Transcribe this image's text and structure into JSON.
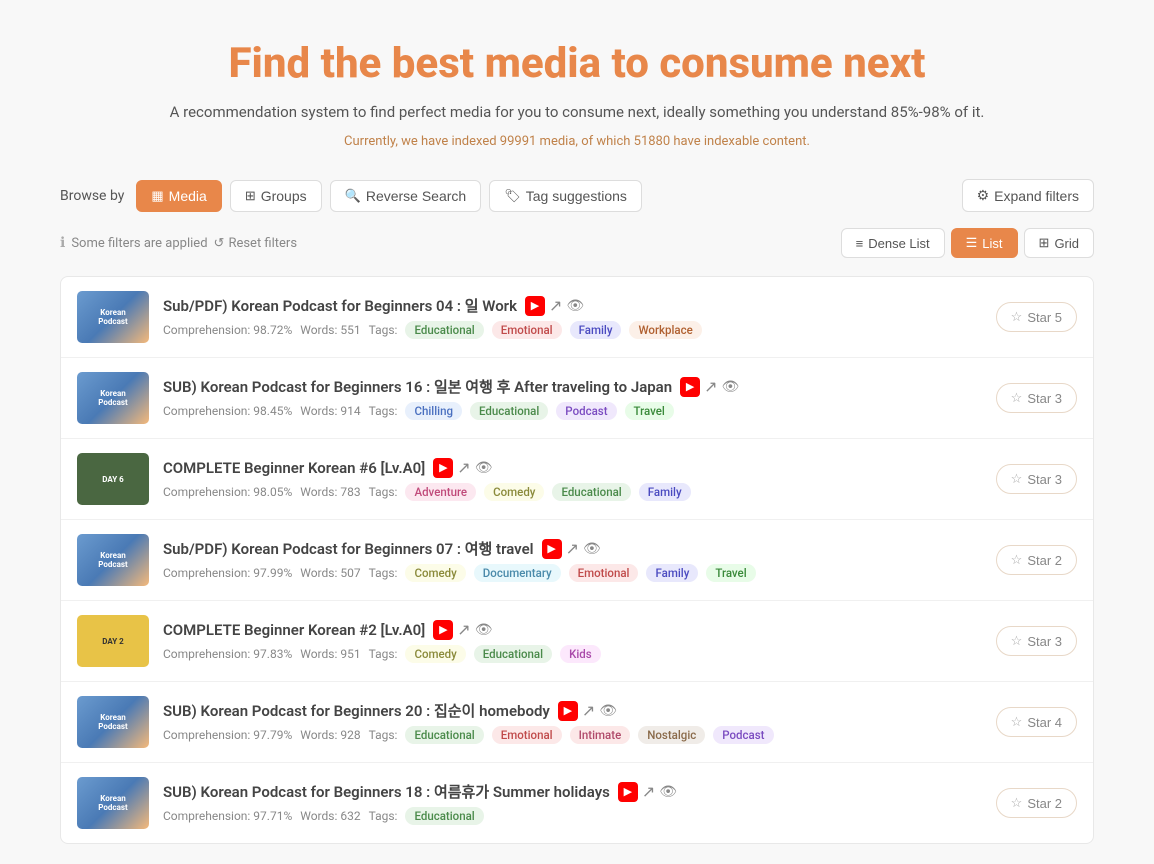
{
  "page": {
    "title": "Find the best media to consume next",
    "subtitle": "A recommendation system to find perfect media for you to consume next, ideally something you understand 85%-98% of it.",
    "stats": "Currently, we have indexed 99991 media, of which 51880 have indexable content."
  },
  "browse": {
    "label": "Browse by",
    "buttons": [
      {
        "id": "media",
        "label": "Media",
        "icon": "▦",
        "active": true
      },
      {
        "id": "groups",
        "label": "Groups",
        "icon": "⊞",
        "active": false
      },
      {
        "id": "reverse",
        "label": "Reverse Search",
        "icon": "🔍",
        "active": false
      },
      {
        "id": "tags",
        "label": "Tag suggestions",
        "icon": "🏷",
        "active": false
      }
    ],
    "expand_label": "Expand filters"
  },
  "filters": {
    "info": "Some filters are applied",
    "reset": "Reset filters"
  },
  "view": {
    "options": [
      {
        "id": "dense",
        "label": "Dense List",
        "icon": "≡",
        "active": false
      },
      {
        "id": "list",
        "label": "List",
        "icon": "☰",
        "active": true
      },
      {
        "id": "grid",
        "label": "Grid",
        "icon": "⊞",
        "active": false
      }
    ]
  },
  "media_items": [
    {
      "id": 1,
      "title": "Sub/PDF) Korean Podcast for Beginners 04 : 일 Work",
      "thumb_type": "podcast",
      "comprehension": "98.72%",
      "words": "551",
      "tags": [
        "Educational",
        "Emotional",
        "Family",
        "Workplace"
      ],
      "tag_types": [
        "educational",
        "emotional",
        "family",
        "workplace"
      ],
      "has_yt": true,
      "has_ext": true,
      "has_eye": true,
      "stars": 5
    },
    {
      "id": 2,
      "title": "SUB) Korean Podcast for Beginners 16 : 일본 여행 후 After traveling to Japan",
      "thumb_type": "podcast",
      "comprehension": "98.45%",
      "words": "914",
      "tags": [
        "Chilling",
        "Educational",
        "Podcast",
        "Travel"
      ],
      "tag_types": [
        "chilling",
        "educational",
        "podcast",
        "travel"
      ],
      "has_yt": true,
      "has_ext": true,
      "has_eye": true,
      "stars": 3
    },
    {
      "id": 3,
      "title": "COMPLETE Beginner Korean #6 [Lv.A0]",
      "thumb_type": "day6",
      "thumb_label": "DAY 6",
      "comprehension": "98.05%",
      "words": "783",
      "tags": [
        "Adventure",
        "Comedy",
        "Educational",
        "Family"
      ],
      "tag_types": [
        "adventure",
        "comedy",
        "educational",
        "family"
      ],
      "has_yt": true,
      "has_ext": true,
      "has_eye": true,
      "stars": 3
    },
    {
      "id": 4,
      "title": "Sub/PDF) Korean Podcast for Beginners 07 : 여행 travel",
      "thumb_type": "podcast",
      "comprehension": "97.99%",
      "words": "507",
      "tags": [
        "Comedy",
        "Documentary",
        "Emotional",
        "Family",
        "Travel"
      ],
      "tag_types": [
        "comedy",
        "documentary",
        "emotional",
        "family",
        "travel"
      ],
      "has_yt": true,
      "has_ext": true,
      "has_eye": true,
      "stars": 2
    },
    {
      "id": 5,
      "title": "COMPLETE Beginner Korean #2 [Lv.A0]",
      "thumb_type": "day2",
      "thumb_label": "DAY 2",
      "comprehension": "97.83%",
      "words": "951",
      "tags": [
        "Comedy",
        "Educational",
        "Kids"
      ],
      "tag_types": [
        "comedy",
        "educational",
        "kids"
      ],
      "has_yt": true,
      "has_ext": true,
      "has_eye": true,
      "stars": 3
    },
    {
      "id": 6,
      "title": "SUB) Korean Podcast for Beginners 20 : 집순이 homebody",
      "thumb_type": "podcast",
      "comprehension": "97.79%",
      "words": "928",
      "tags": [
        "Educational",
        "Emotional",
        "Intimate",
        "Nostalgic",
        "Podcast"
      ],
      "tag_types": [
        "educational",
        "emotional",
        "intimate",
        "nostalgic",
        "podcast"
      ],
      "has_yt": true,
      "has_ext": true,
      "has_eye": true,
      "stars": 4
    },
    {
      "id": 7,
      "title": "SUB) Korean Podcast for Beginners 18 : 여름휴가 Summer holidays",
      "thumb_type": "podcast",
      "comprehension": "97.71%",
      "words": "632",
      "tags": [
        "Educational"
      ],
      "tag_types": [
        "educational"
      ],
      "has_yt": true,
      "has_ext": true,
      "has_eye": true,
      "stars": 2
    }
  ],
  "labels": {
    "comprehension": "Comprehension:",
    "words": "Words:",
    "tags": "Tags:",
    "star": "Star"
  }
}
